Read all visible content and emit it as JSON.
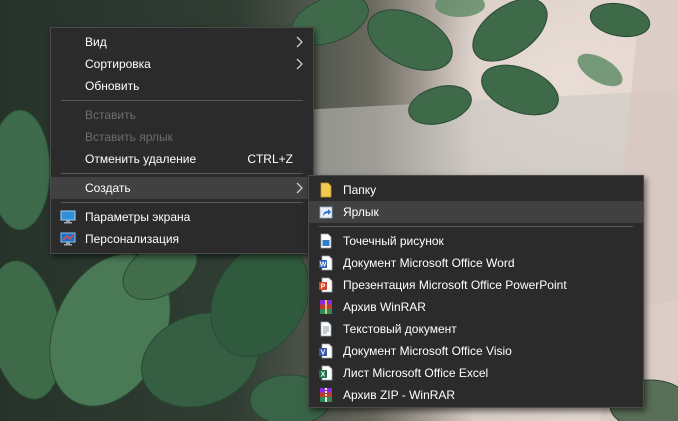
{
  "context_menu": {
    "items": [
      {
        "label": "Вид",
        "has_submenu": true,
        "enabled": true
      },
      {
        "label": "Сортировка",
        "has_submenu": true,
        "enabled": true
      },
      {
        "label": "Обновить",
        "enabled": true
      },
      {
        "label": "Вставить",
        "enabled": false
      },
      {
        "label": "Вставить ярлык",
        "enabled": false
      },
      {
        "label": "Отменить удаление",
        "shortcut": "CTRL+Z",
        "enabled": true
      },
      {
        "label": "Создать",
        "has_submenu": true,
        "enabled": true,
        "highlighted": true
      },
      {
        "label": "Параметры экрана",
        "icon": "display-settings-icon",
        "enabled": true
      },
      {
        "label": "Персонализация",
        "icon": "personalization-icon",
        "enabled": true
      }
    ]
  },
  "create_submenu": {
    "items": [
      {
        "label": "Папку",
        "icon": "folder-icon"
      },
      {
        "label": "Ярлык",
        "icon": "shortcut-icon",
        "highlighted": true
      },
      {
        "label": "Точечный рисунок",
        "icon": "bitmap-icon"
      },
      {
        "label": "Документ Microsoft Office Word",
        "icon": "word-icon"
      },
      {
        "label": "Презентация Microsoft Office PowerPoint",
        "icon": "powerpoint-icon"
      },
      {
        "label": "Архив WinRAR",
        "icon": "winrar-icon"
      },
      {
        "label": "Текстовый документ",
        "icon": "text-document-icon"
      },
      {
        "label": "Документ Microsoft Office Visio",
        "icon": "visio-icon"
      },
      {
        "label": "Лист Microsoft Office Excel",
        "icon": "excel-icon"
      },
      {
        "label": "Архив ZIP - WinRAR",
        "icon": "winrar-zip-icon"
      }
    ]
  },
  "colors": {
    "menu_background": "#2b2b2b",
    "menu_highlight": "#414141",
    "text": "#ffffff",
    "text_disabled": "#6d6d6d"
  }
}
